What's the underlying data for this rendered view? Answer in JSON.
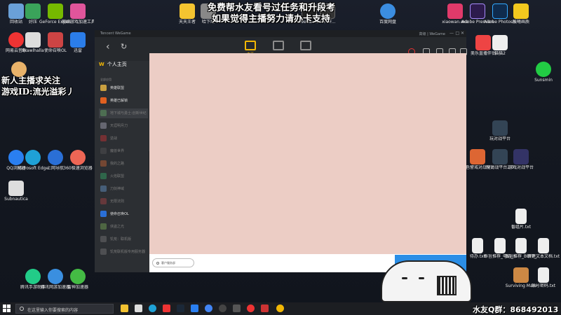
{
  "overlay": {
    "line1": "免费帮水友看号过任务和升段考",
    "line2": "如果觉得主播努力请办卡支持",
    "left1": "新人主播求关注",
    "left2": "游戏ID:流光溢彩丿",
    "qq": "水友Q群：868492013"
  },
  "desktop_icons": [
    {
      "label": "回收站",
      "color": "#6aa0d8"
    },
    {
      "label": "好压",
      "color": "#3aa35a"
    },
    {
      "label": "GeForce Experience",
      "color": "#76b900"
    },
    {
      "label": "网络游戏加速工具",
      "color": "#e0559b"
    },
    {
      "label": "网易云音乐",
      "color": "#e33"
    },
    {
      "label": "Brawlhalla",
      "color": "#ddd"
    },
    {
      "label": "使命召唤OL",
      "color": "#c44"
    },
    {
      "label": "迅雷",
      "color": "#2b7de9"
    },
    {
      "label": "QQ浏览器",
      "color": "#2a7ff0"
    },
    {
      "label": "Microsoft Edge",
      "color": "#1fa1d6"
    },
    {
      "label": "上网导航",
      "color": "#2a6fd6"
    },
    {
      "label": "360极速浏览器",
      "color": "#e65"
    },
    {
      "label": "Subnautica",
      "color": "#ddd"
    },
    {
      "label": "腾讯手游助手",
      "color": "#2c8"
    },
    {
      "label": "腾讯网游加速器",
      "color": "#3a8fe0"
    },
    {
      "label": "雷神加速器",
      "color": "#4b4"
    },
    {
      "label": "百度网盘",
      "color": "#3b8de0"
    },
    {
      "label": "xiaowan.exe",
      "color": "#e03a6a"
    },
    {
      "label": "Adobe Premiere P...",
      "color": "#2d1b4d"
    },
    {
      "label": "Adobe Photosh...",
      "color": "#0f2b4d"
    },
    {
      "label": "晨曦画质",
      "color": "#f2c81e"
    },
    {
      "label": "Sunsmin",
      "color": "#2c4"
    },
    {
      "label": "1.1",
      "color": "#eee"
    },
    {
      "label": "玩对战平台",
      "color": "#345"
    },
    {
      "label": "红色警戒对战平台",
      "color": "#d63"
    },
    {
      "label": "玩对战平台2.0",
      "color": "#345"
    },
    {
      "label": "游戏对战平台",
      "color": "#336"
    },
    {
      "label": "番组片.txt",
      "color": "#eee"
    },
    {
      "label": "待办.txt",
      "color": "#eee"
    },
    {
      "label": "奉旨推荐_电话_ID.txt",
      "color": "#eee"
    },
    {
      "label": "奉旨推荐_BUFF_ID.txt",
      "color": "#eee"
    },
    {
      "label": "新建文本文档.txt",
      "color": "#eee"
    },
    {
      "label": "Surviving Mars",
      "color": "#c84"
    },
    {
      "label": "账号密码.txt",
      "color": "#eee"
    },
    {
      "label": "天天王者",
      "color": "#f4c430"
    },
    {
      "label": "哈下载",
      "color": "#888"
    },
    {
      "label": "WeGame",
      "color": "#222"
    },
    {
      "label": "Taro F...",
      "color": "#333"
    },
    {
      "label": "美乐直播伴侣",
      "color": "#e44"
    },
    {
      "label": "猫猫2",
      "color": "#eee"
    }
  ],
  "wegame": {
    "title": "Tencent WeGame",
    "right_title": "高级 | WeGame",
    "home_label": "主页",
    "sidebar_header": "个人主页",
    "sidebar_section": "全部应用",
    "sidebar_items": [
      {
        "label": "英雄联盟",
        "color": "#c9a040",
        "dim": false
      },
      {
        "label": "英雄已解锁",
        "color": "#e06020",
        "dim": false
      },
      {
        "label": "地下城与勇士:创新世纪",
        "color": "#6a6",
        "dim": true
      },
      {
        "label": "天涯明月刀",
        "color": "#aab",
        "dim": true
      },
      {
        "label": "逆战",
        "color": "#c33",
        "dim": true
      },
      {
        "label": "魔兽世界",
        "color": "#555",
        "dim": true
      },
      {
        "label": "我的之路",
        "color": "#c63",
        "dim": true
      },
      {
        "label": "火焰联盟",
        "color": "#3a6",
        "dim": true
      },
      {
        "label": "刀剑神域",
        "color": "#69c",
        "dim": true
      },
      {
        "label": "无限法则",
        "color": "#a44",
        "dim": true
      },
      {
        "label": "使命召唤OL",
        "color": "#2a6fd6",
        "dim": false
      },
      {
        "label": "侠盗之光",
        "color": "#7a5",
        "dim": true
      },
      {
        "label": "饥荒：联机版",
        "color": "#777",
        "dim": true
      },
      {
        "label": "饥荒联机版专用服务器",
        "color": "#777",
        "dim": true
      }
    ],
    "customer_service": "客户服务部",
    "download": "下载"
  },
  "taskbar": {
    "search_placeholder": "在这里输入你要搜索的内容"
  }
}
